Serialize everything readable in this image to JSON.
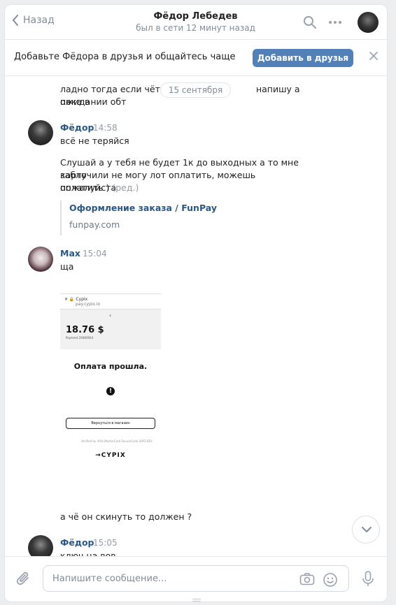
{
  "header": {
    "back_label": "Назад",
    "title": "Фёдор Лебедев",
    "subtitle": "был в сети 12 минут назад"
  },
  "banner": {
    "text": "Добавьте Фёдора в друзья и общайтесь чаще",
    "button_label": "Добавить в друзья"
  },
  "feed": {
    "date_divider": "15 сентября",
    "partial_message_line1": "ладно тогда если чёт бу",
    "partial_message_line1_tail": "напишу а пока в",
    "partial_message_line2": "ожидании обт",
    "messages": [
      {
        "author": "Фёдор",
        "time": "14:58",
        "text1": "всё не теряйся",
        "text2_line1": "Слушай а у тебя не будет 1к до выходных а то мне карту",
        "text2_line2": "заблочили не могу лот оплатить, можешь пожалуйста",
        "text2_line3": "оплатить )",
        "edited": "(ред.)",
        "link_title": "Оформление заказа / FunPay",
        "link_domain": "funpay.com"
      },
      {
        "author": "Max",
        "time": "15:04",
        "text1": "ща",
        "screenshot": {
          "merchant": "Cypix",
          "merchant_url": "pay.cypix.io",
          "amount": "18.76 $",
          "payment_id": "Payment 20460924",
          "status": "Оплата прошла.",
          "return_button": "Вернуться в магазин",
          "card_logos": "Verified by VISA   MasterCard SecureCode   SAFE KEY",
          "brand": "CYPIX"
        },
        "text2": "а чё он скинуть то должен ?"
      },
      {
        "author": "Фёдор",
        "time": "15:05",
        "text1": "ключ на вов"
      }
    ]
  },
  "composer": {
    "placeholder": "Напишите сообщение..."
  },
  "colors": {
    "accent": "#5181b8",
    "link": "#2a5885",
    "muted": "#818c99"
  },
  "icons": [
    "chevron-left-icon",
    "search-icon",
    "more-icon",
    "close-icon",
    "chevron-down-icon",
    "paperclip-icon",
    "camera-icon",
    "smile-icon",
    "microphone-icon",
    "warning-icon"
  ]
}
